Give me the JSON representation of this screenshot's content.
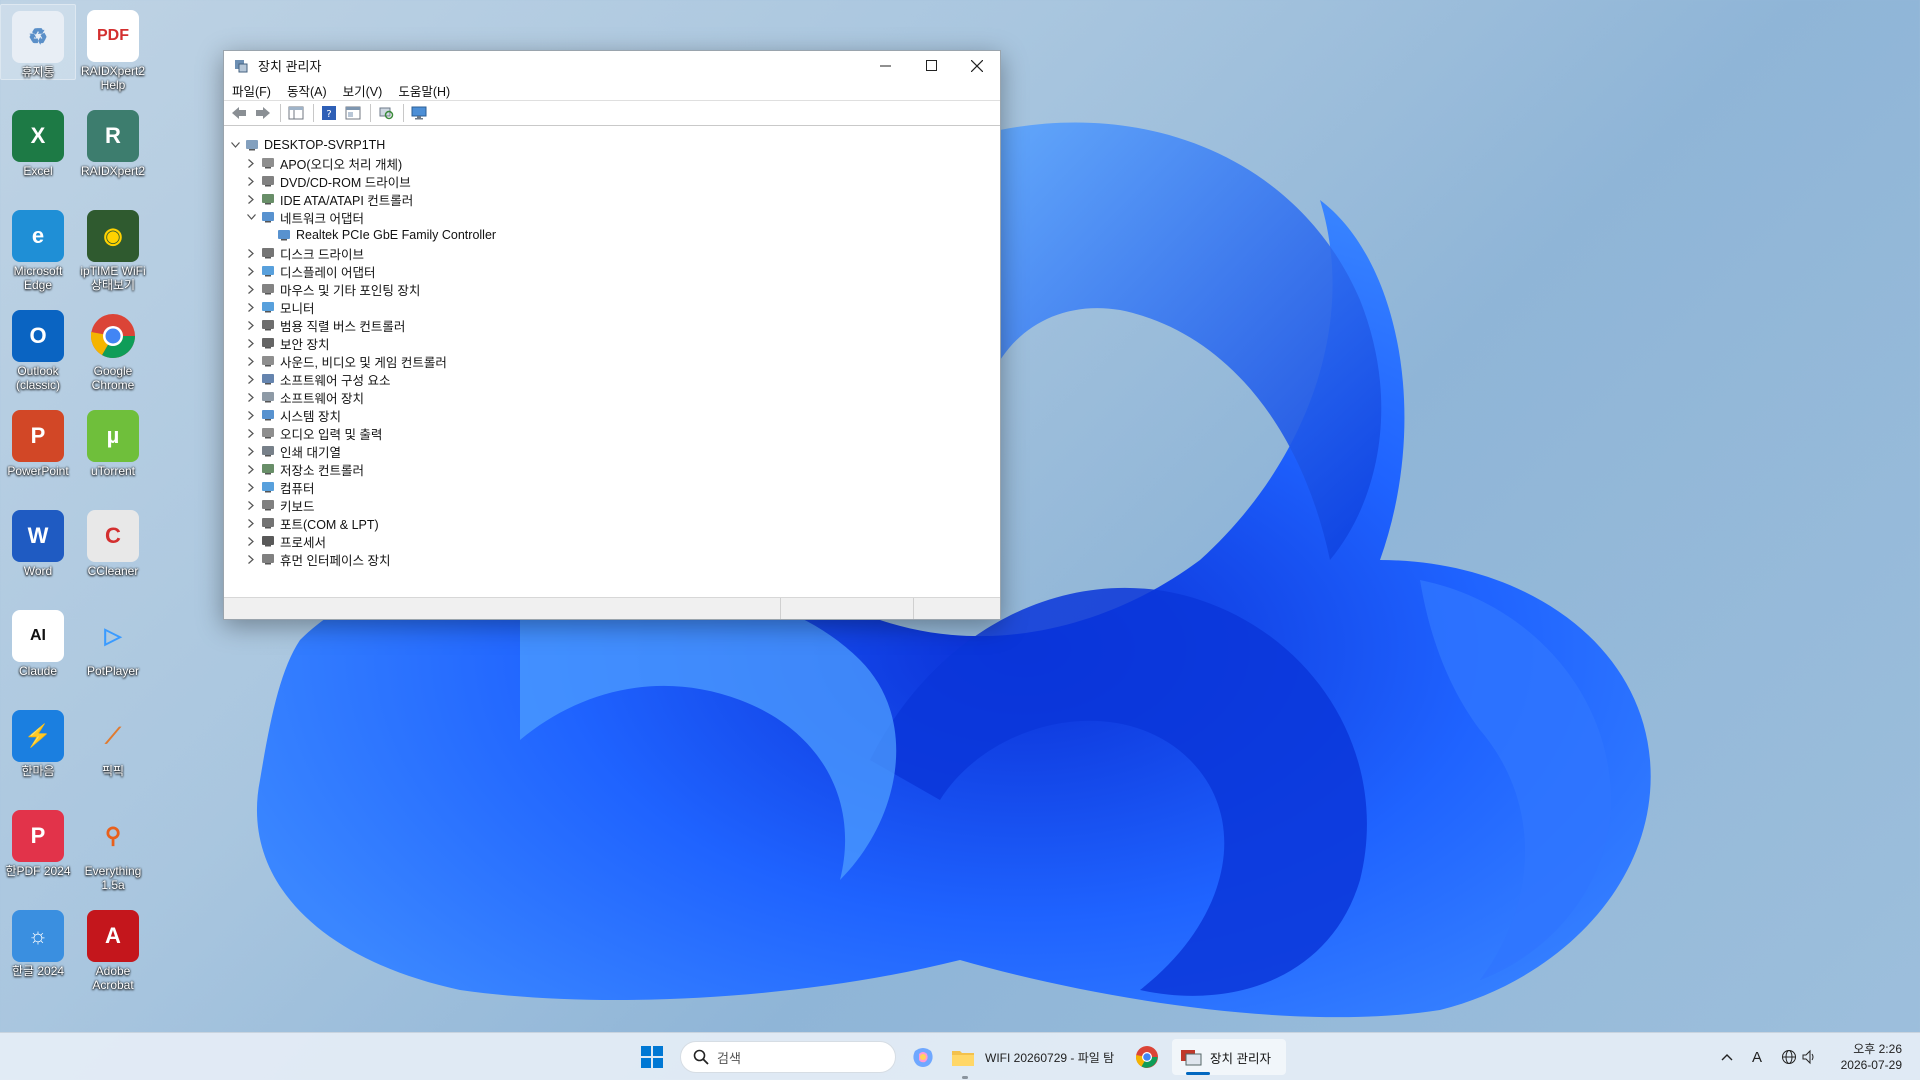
{
  "desktop": {
    "icons": [
      {
        "label": "휴지통",
        "icon": "recycle-bin-icon"
      },
      {
        "label": "RAIDXpert2 Help",
        "icon": "pdf-file-icon"
      },
      {
        "label": "Excel",
        "icon": "excel-icon"
      },
      {
        "label": "RAIDXpert2",
        "icon": "raidxpert-icon"
      },
      {
        "label": "Microsoft Edge",
        "icon": "edge-icon"
      },
      {
        "label": "ipTIME WiFi 상태보기",
        "icon": "iptime-wifi-icon"
      },
      {
        "label": "Outlook (classic)",
        "icon": "outlook-icon"
      },
      {
        "label": "Google Chrome",
        "icon": "chrome-icon"
      },
      {
        "label": "PowerPoint",
        "icon": "powerpoint-icon"
      },
      {
        "label": "uTorrent",
        "icon": "utorrent-icon"
      },
      {
        "label": "Word",
        "icon": "word-icon"
      },
      {
        "label": "CCleaner",
        "icon": "ccleaner-icon"
      },
      {
        "label": "Claude",
        "icon": "claude-icon"
      },
      {
        "label": "PotPlayer",
        "icon": "potplayer-icon"
      },
      {
        "label": "한마음",
        "icon": "lightning-icon"
      },
      {
        "label": "픽픽",
        "icon": "picpick-icon"
      },
      {
        "label": "한PDF 2024",
        "icon": "hanpdf-icon"
      },
      {
        "label": "Everything 1.5a",
        "icon": "everything-search-icon"
      },
      {
        "label": "한글 2024",
        "icon": "hangul-icon"
      },
      {
        "label": "Adobe Acrobat",
        "icon": "acrobat-icon"
      }
    ]
  },
  "window": {
    "title": "장치 관리자",
    "menu": [
      "파일(F)",
      "동작(A)",
      "보기(V)",
      "도움말(H)"
    ],
    "tree": {
      "root": "DESKTOP-SVRP1TH",
      "categories": [
        {
          "label": "APO(오디오 처리 개체)",
          "icon": "audio-icon",
          "expanded": false
        },
        {
          "label": "DVD/CD-ROM 드라이브",
          "icon": "dvd-drive-icon",
          "expanded": false
        },
        {
          "label": "IDE ATA/ATAPI 컨트롤러",
          "icon": "ide-controller-icon",
          "expanded": false
        },
        {
          "label": "네트워크 어댑터",
          "icon": "network-adapter-icon",
          "expanded": true,
          "children": [
            "Realtek PCIe GbE Family Controller"
          ]
        },
        {
          "label": "디스크 드라이브",
          "icon": "disk-drive-icon",
          "expanded": false
        },
        {
          "label": "디스플레이 어댑터",
          "icon": "display-adapter-icon",
          "expanded": false
        },
        {
          "label": "마우스 및 기타 포인팅 장치",
          "icon": "mouse-icon",
          "expanded": false
        },
        {
          "label": "모니터",
          "icon": "monitor-icon",
          "expanded": false
        },
        {
          "label": "범용 직렬 버스 컨트롤러",
          "icon": "usb-icon",
          "expanded": false
        },
        {
          "label": "보안 장치",
          "icon": "security-device-icon",
          "expanded": false
        },
        {
          "label": "사운드, 비디오 및 게임 컨트롤러",
          "icon": "sound-icon",
          "expanded": false
        },
        {
          "label": "소프트웨어 구성 요소",
          "icon": "software-component-icon",
          "expanded": false
        },
        {
          "label": "소프트웨어 장치",
          "icon": "software-device-icon",
          "expanded": false
        },
        {
          "label": "시스템 장치",
          "icon": "system-device-icon",
          "expanded": false
        },
        {
          "label": "오디오 입력 및 출력",
          "icon": "audio-io-icon",
          "expanded": false
        },
        {
          "label": "인쇄 대기열",
          "icon": "printer-icon",
          "expanded": false
        },
        {
          "label": "저장소 컨트롤러",
          "icon": "storage-controller-icon",
          "expanded": false
        },
        {
          "label": "컴퓨터",
          "icon": "computer-icon",
          "expanded": false
        },
        {
          "label": "키보드",
          "icon": "keyboard-icon",
          "expanded": false
        },
        {
          "label": "포트(COM & LPT)",
          "icon": "port-icon",
          "expanded": false
        },
        {
          "label": "프로세서",
          "icon": "processor-icon",
          "expanded": false
        },
        {
          "label": "휴먼 인터페이스 장치",
          "icon": "hid-icon",
          "expanded": false
        }
      ]
    }
  },
  "taskbar": {
    "search_placeholder": "검색",
    "apps": [
      {
        "label": "WIFI 20260729 - 파일 탐",
        "icon": "folder-icon"
      },
      {
        "label": "장치 관리자",
        "icon": "device-manager-icon"
      }
    ],
    "tray": {
      "ime": "A"
    },
    "clock": {
      "time": "오후 2:26",
      "date": "2026-07-29"
    }
  },
  "colors": {
    "accent": "#0067c0",
    "wallpaper_blue": "#1a5cff"
  }
}
